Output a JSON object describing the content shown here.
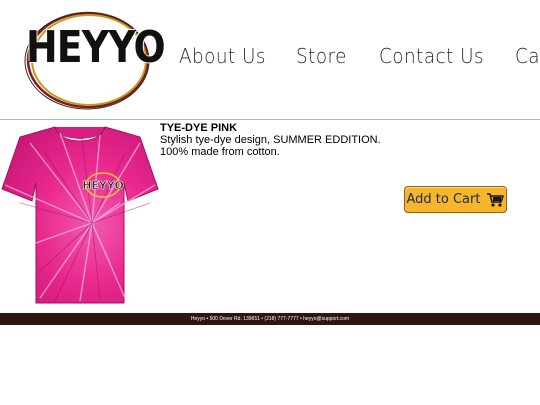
{
  "header": {
    "logo_text": "HEYYO",
    "nav": [
      {
        "label": "About Us"
      },
      {
        "label": "Store"
      },
      {
        "label": "Contact Us"
      },
      {
        "label": "Cart"
      }
    ]
  },
  "product": {
    "title": "TYE-DYE PINK",
    "description_line1": "Stylish tye-dye design, SUMMER EDDITION.",
    "description_line2": "100% made from cotton.",
    "shirt_logo_text": "HEYYO",
    "add_to_cart_label": "Add to Cart",
    "shirt_color": "#e8288c",
    "button_color": "#f7b52b"
  },
  "footer": {
    "text": "Heyyo • 500 Dover Rd. 139651 • (218) 777-7777 • heyyo@support.com"
  },
  "icons": [
    "logo-circle-icon",
    "shopping-cart-icon"
  ]
}
